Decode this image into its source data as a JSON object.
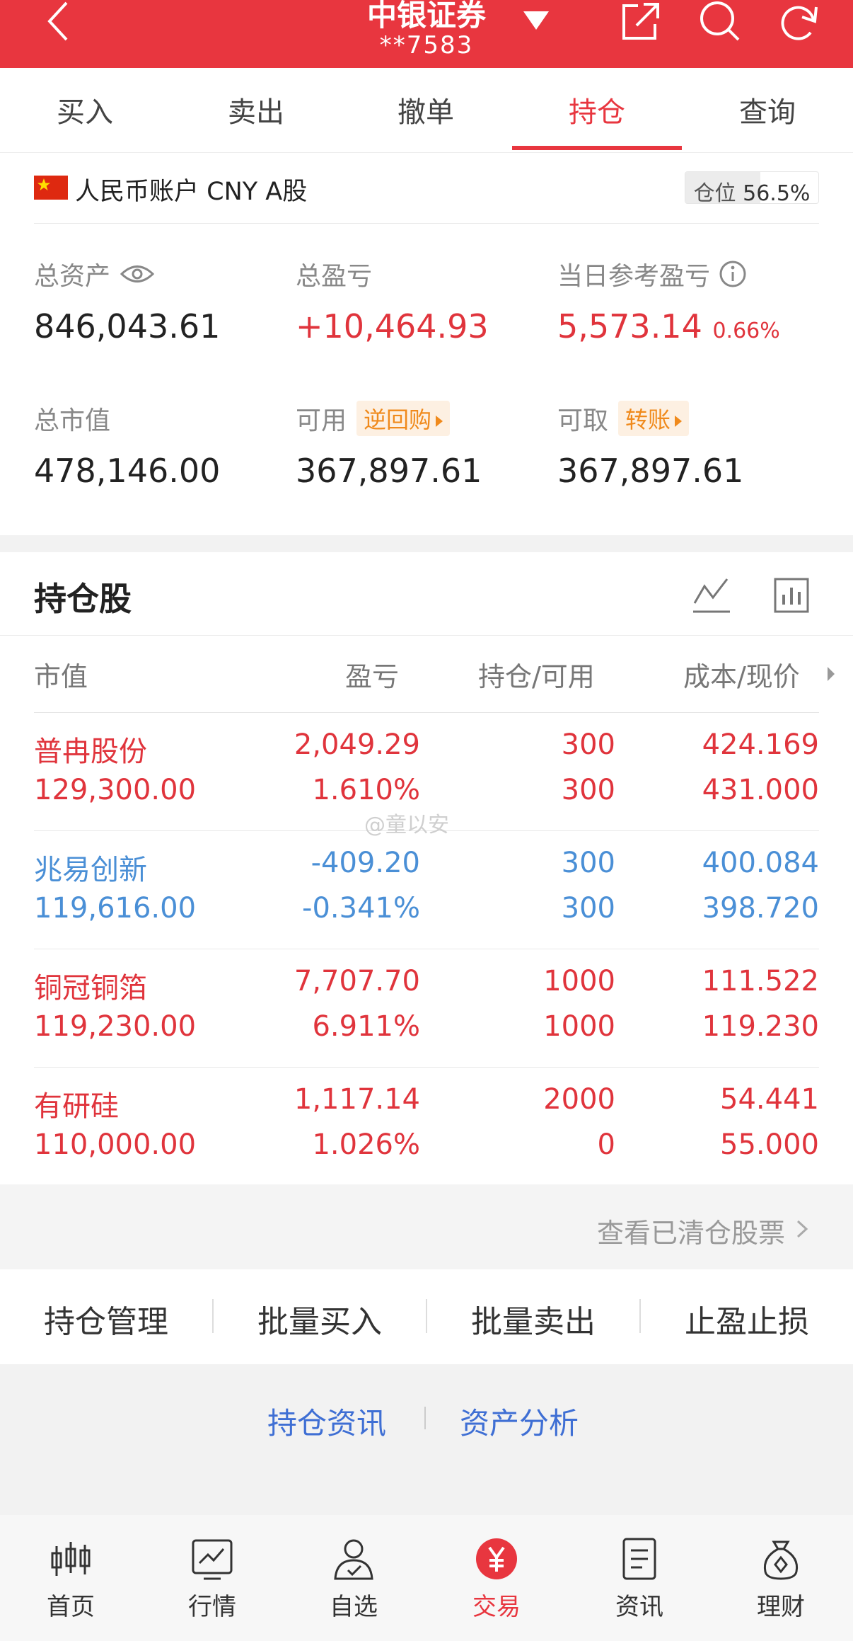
{
  "header": {
    "title": "中银证券",
    "account_mask": "**7583",
    "icons": [
      "back-icon",
      "dropdown-icon",
      "share-icon",
      "search-icon",
      "refresh-icon"
    ]
  },
  "tabs": [
    {
      "label": "买入"
    },
    {
      "label": "卖出"
    },
    {
      "label": "撤单"
    },
    {
      "label": "持仓",
      "active": true
    },
    {
      "label": "查询"
    }
  ],
  "account": {
    "label": "人民币账户 CNY A股",
    "position_label": "仓位",
    "position_value": "56.5%",
    "position_fraction": 0.565
  },
  "metrics": {
    "total_assets_label": "总资产",
    "total_assets": "846,043.61",
    "total_pnl_label": "总盈亏",
    "total_pnl": "+10,464.93",
    "daily_pnl_label": "当日参考盈亏",
    "daily_pnl": "5,573.14",
    "daily_pnl_pct": "0.66%",
    "market_value_label": "总市值",
    "market_value": "478,146.00",
    "available_label": "可用",
    "available_chip": "逆回购",
    "available": "367,897.61",
    "withdrawable_label": "可取",
    "withdrawable_chip": "转账",
    "withdrawable": "367,897.61"
  },
  "holdings": {
    "title": "持仓股",
    "columns": [
      "市值",
      "盈亏",
      "持仓/可用",
      "成本/现价"
    ],
    "rows": [
      {
        "name": "普冉股份",
        "market_value": "129,300.00",
        "pnl": "2,049.29",
        "pnl_pct": "1.610%",
        "position": "300",
        "available": "300",
        "cost": "424.169",
        "price": "431.000",
        "color": "red"
      },
      {
        "name": "兆易创新",
        "market_value": "119,616.00",
        "pnl": "-409.20",
        "pnl_pct": "-0.341%",
        "position": "300",
        "available": "300",
        "cost": "400.084",
        "price": "398.720",
        "color": "blue"
      },
      {
        "name": "铜冠铜箔",
        "market_value": "119,230.00",
        "pnl": "7,707.70",
        "pnl_pct": "6.911%",
        "position": "1000",
        "available": "1000",
        "cost": "111.522",
        "price": "119.230",
        "color": "red"
      },
      {
        "name": "有研硅",
        "market_value": "110,000.00",
        "pnl": "1,117.14",
        "pnl_pct": "1.026%",
        "position": "2000",
        "available": "0",
        "cost": "54.441",
        "price": "55.000",
        "color": "red"
      }
    ],
    "watermark": "@童以安",
    "view_cleared": "查看已清仓股票"
  },
  "actions": [
    {
      "label": "持仓管理"
    },
    {
      "label": "批量买入"
    },
    {
      "label": "批量卖出"
    },
    {
      "label": "止盈止损"
    }
  ],
  "links": [
    {
      "label": "持仓资讯"
    },
    {
      "label": "资产分析"
    }
  ],
  "bottom_nav": [
    {
      "label": "首页",
      "icon": "candlestick-icon"
    },
    {
      "label": "行情",
      "icon": "chart-icon"
    },
    {
      "label": "自选",
      "icon": "user-check-icon"
    },
    {
      "label": "交易",
      "icon": "yuan-icon",
      "active": true
    },
    {
      "label": "资讯",
      "icon": "document-icon"
    },
    {
      "label": "理财",
      "icon": "money-bag-icon"
    }
  ],
  "colors": {
    "brand_red": "#e8363f",
    "gain": "#e0343c",
    "loss": "#4a8fd6",
    "chip": "#f08a1c",
    "link": "#3f6fd4"
  }
}
